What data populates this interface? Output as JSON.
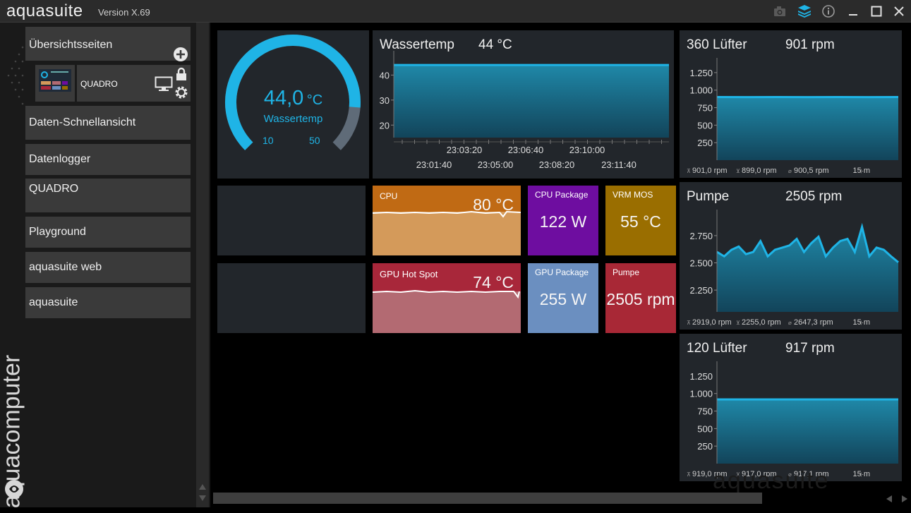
{
  "app": {
    "title": "aquasuite",
    "version": "Version X.69",
    "brand": "aquacomputer",
    "watermark": "aquasuite"
  },
  "colors": {
    "accent": "#1fb4e6",
    "panel": "#22262b",
    "cpu": "#d49a5a",
    "cpu_header": "#c06a14",
    "gpu": "#b36a72",
    "gpu_header": "#a8273a",
    "cpu_pkg": "#6e0da0",
    "vrm": "#9a6e00",
    "gpu_pkg": "#6b8fc0",
    "pump": "#a82836"
  },
  "sidebar": {
    "overview": "Übersichtsseiten",
    "device": "QUADRO",
    "items": [
      "Daten-Schnellansicht",
      "Datenlogger",
      "QUADRO",
      "Playground",
      "aquasuite web",
      "aquasuite"
    ]
  },
  "gauge": {
    "value": "44,0",
    "unit": "°C",
    "label": "Wassertemp",
    "min": "10",
    "max": "50",
    "fraction": 0.85
  },
  "water_chart": {
    "title": "Wassertemp",
    "current": "44 °C",
    "y_ticks": [
      "40",
      "30",
      "20"
    ],
    "x_ticks_top": [
      "23:03:20",
      "23:06:40",
      "23:10:00"
    ],
    "x_ticks_bottom": [
      "23:01:40",
      "23:05:00",
      "23:08:20",
      "23:11:40"
    ]
  },
  "tiles": {
    "cpu": {
      "label": "CPU",
      "value": "80 °C"
    },
    "gpu": {
      "label": "GPU Hot Spot",
      "value": "74 °C"
    },
    "cpu_package": {
      "label": "CPU Package",
      "value": "122 W"
    },
    "vrm": {
      "label": "VRM MOS",
      "value": "55 °C"
    },
    "gpu_package": {
      "label": "GPU Package",
      "value": "255 W"
    },
    "pump": {
      "label": "Pumpe",
      "value": "2505 rpm"
    }
  },
  "charts": [
    {
      "title": "360 Lüfter",
      "current": "901 rpm",
      "y_ticks": [
        "1.250",
        "1.000",
        "750",
        "500",
        "250"
      ],
      "stats": [
        "901,0 rpm",
        "899,0 rpm",
        "900,5 rpm",
        "15 m"
      ]
    },
    {
      "title": "Pumpe",
      "current": "2505 rpm",
      "y_ticks": [
        "2.750",
        "2.500",
        "2.250"
      ],
      "stats": [
        "2919,0 rpm",
        "2255,0 rpm",
        "2647,3 rpm",
        "15 m"
      ]
    },
    {
      "title": "120 Lüfter",
      "current": "917 rpm",
      "y_ticks": [
        "1.000",
        "750",
        "500",
        "250"
      ],
      "y_ticks_top": "1.250",
      "stats": [
        "919,0 rpm",
        "917,0 rpm",
        "917,1 rpm",
        "15 m"
      ]
    }
  ],
  "chart_data": [
    {
      "type": "area",
      "title": "Wassertemp",
      "ylim": [
        15,
        48
      ],
      "values": [
        44,
        44,
        44,
        44,
        44,
        44,
        44,
        44,
        44,
        44
      ]
    },
    {
      "type": "area",
      "title": "360 Lüfter",
      "ylim": [
        0,
        1400
      ],
      "values": [
        901,
        900,
        901,
        900,
        901,
        900,
        901
      ]
    },
    {
      "type": "area",
      "title": "Pumpe",
      "ylim": [
        2050,
        2950
      ],
      "values": [
        2600,
        2560,
        2620,
        2650,
        2580,
        2600,
        2700,
        2560,
        2620,
        2640,
        2660,
        2720,
        2600,
        2680,
        2740,
        2560,
        2640,
        2700,
        2720,
        2600,
        2830,
        2560,
        2640,
        2620,
        2560,
        2505
      ]
    },
    {
      "type": "area",
      "title": "120 Lüfter",
      "ylim": [
        0,
        1400
      ],
      "values": [
        917,
        917,
        917,
        917,
        917,
        917
      ]
    }
  ]
}
